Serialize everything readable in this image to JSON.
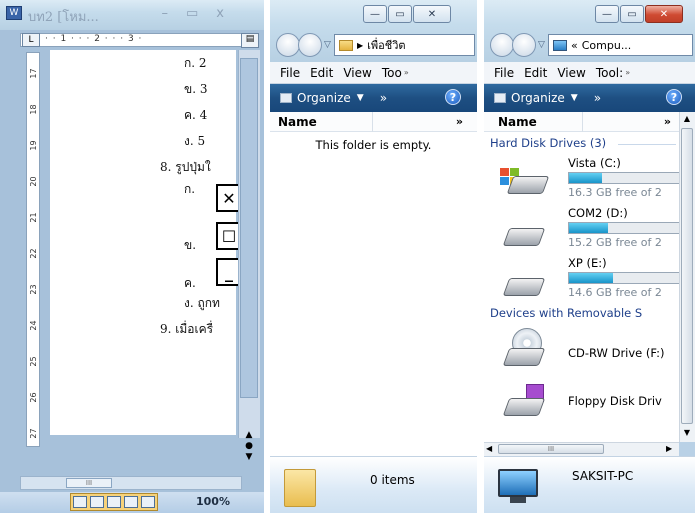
{
  "word": {
    "title": "บท2 [โหม...",
    "ruler_text": "· · 1 · · · 2 · · · 3 ·",
    "vruler_numbers": [
      "17",
      "18",
      "19",
      "20",
      "21",
      "22",
      "23",
      "24",
      "25",
      "26",
      "27"
    ],
    "lines": {
      "k2": "ก.  2",
      "kh3": "ข.  3",
      "kh4": "ค.  4",
      "ng5": "ง.  5",
      "q8": "8.  รูปปุ่มใ",
      "a_k": "ก.",
      "a_kh": "ข.",
      "a_kk": "ค.",
      "a_ng": "ง.  ถูกท",
      "q9": "9.  เมื่อเครื่"
    },
    "zoom": "100%",
    "hscroll_label": "III"
  },
  "explorer1": {
    "address": "เพื่อชีวิต",
    "menu": [
      "File",
      "Edit",
      "View",
      "Too"
    ],
    "organize": "Organize",
    "column_name": "Name",
    "empty_text": "This folder is empty.",
    "items_count": "0 items"
  },
  "explorer2": {
    "address": "Compu...",
    "address_prefix": "«",
    "menu": [
      "File",
      "Edit",
      "View",
      "Tool:"
    ],
    "organize": "Organize",
    "column_name": "Name",
    "group_hdd": "Hard Disk Drives (3)",
    "group_removable": "Devices with Removable S",
    "drives": [
      {
        "name": "Vista (C:)",
        "free": "16.3 GB free of 2",
        "used_fraction": 0.3
      },
      {
        "name": "COM2 (D:)",
        "free": "15.2 GB free of 2",
        "used_fraction": 0.35
      },
      {
        "name": "XP (E:)",
        "free": "14.6 GB free of 2",
        "used_fraction": 0.4
      }
    ],
    "removable": [
      {
        "name": "CD-RW Drive (F:)",
        "icon": "cd-drive-icon"
      },
      {
        "name": "Floppy Disk Driv",
        "icon": "floppy-drive-icon"
      }
    ],
    "computer_name": "SAKSIT-PC",
    "hscroll_label": "III"
  }
}
